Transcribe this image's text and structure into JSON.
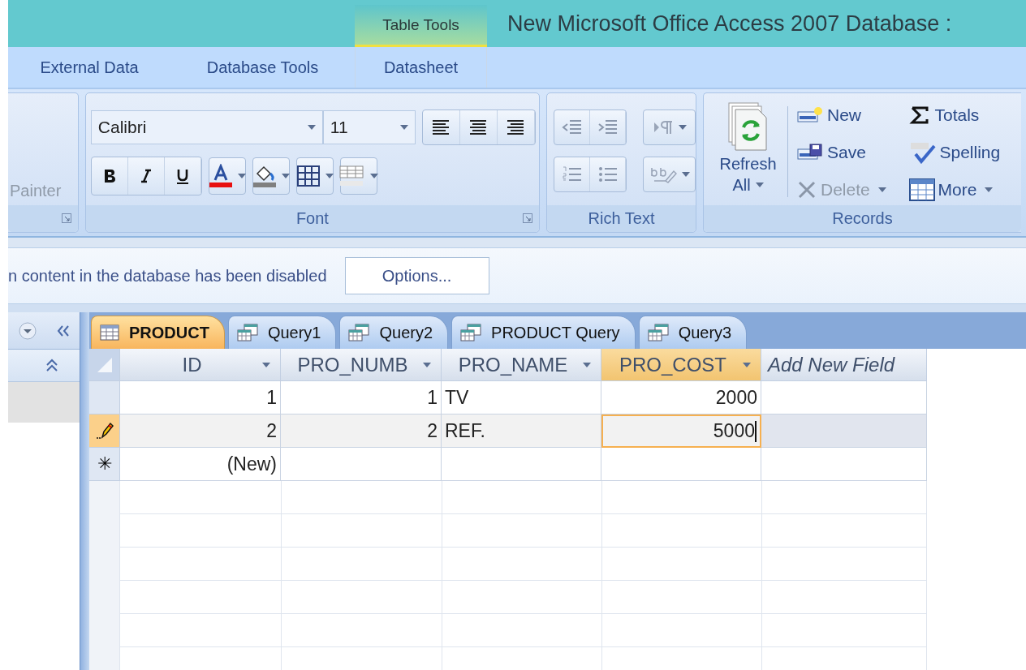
{
  "title_bar": {
    "contextual_group": "Table Tools",
    "title": "New Microsoft Office Access 2007 Database :"
  },
  "ribbon_tabs": [
    {
      "label": "External Data"
    },
    {
      "label": "Database Tools"
    },
    {
      "label": "Datasheet"
    }
  ],
  "ribbon": {
    "clipboard": {
      "partial_button": "Painter",
      "disabled": true
    },
    "font": {
      "label": "Font",
      "font_name": "Calibri",
      "font_size": "11"
    },
    "rich_text": {
      "label": "Rich Text",
      "disabled": true
    },
    "records": {
      "label": "Records",
      "buttons": [
        {
          "kind": "refresh",
          "label": "Refresh",
          "label_2": "All",
          "dropdown": true,
          "disabled": false
        },
        {
          "kind": "new",
          "label": "New",
          "dropdown": false,
          "disabled": false
        },
        {
          "kind": "save",
          "label": "Save",
          "dropdown": false,
          "disabled": false
        },
        {
          "kind": "delete",
          "label": "Delete",
          "dropdown": true,
          "disabled": true
        },
        {
          "kind": "totals",
          "label": "Totals",
          "dropdown": false,
          "disabled": false
        },
        {
          "kind": "spelling",
          "label": "Spelling",
          "dropdown": false,
          "disabled": false
        },
        {
          "kind": "more",
          "label": "More",
          "dropdown": true,
          "disabled": false
        }
      ]
    }
  },
  "message_bar": {
    "text": "n content in the database has been disabled",
    "button": "Options..."
  },
  "document_tabs": [
    {
      "label": "PRODUCT",
      "kind": "table",
      "selected": true
    },
    {
      "label": "Query1",
      "kind": "query",
      "selected": false
    },
    {
      "label": "Query2",
      "kind": "query",
      "selected": false
    },
    {
      "label": "PRODUCT Query",
      "kind": "query",
      "selected": false
    },
    {
      "label": "Query3",
      "kind": "query",
      "selected": false
    }
  ],
  "datasheet": {
    "columns": [
      {
        "label": "ID",
        "kind": "number",
        "selected": false
      },
      {
        "label": "PRO_NUMB",
        "kind": "number",
        "selected": false
      },
      {
        "label": "PRO_NAME",
        "kind": "text",
        "selected": false
      },
      {
        "label": "PRO_COST",
        "kind": "number",
        "selected": true
      },
      {
        "label": "Add New Field",
        "kind": "add"
      }
    ],
    "rows": [
      {
        "kind": "record",
        "cells": [
          "1",
          "1",
          "TV",
          "2000"
        ]
      },
      {
        "kind": "editing",
        "cells": [
          "2",
          "2",
          "REF.",
          "5000"
        ]
      },
      {
        "kind": "new",
        "selector": "✳",
        "cells": [
          "(New)"
        ]
      }
    ]
  }
}
